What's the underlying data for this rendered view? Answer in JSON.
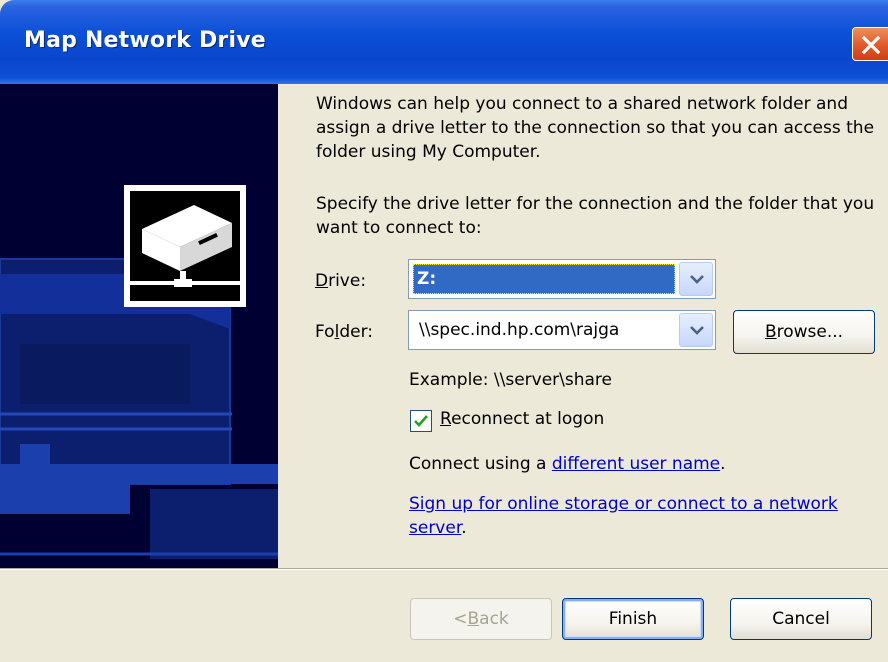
{
  "window": {
    "title": "Map Network Drive"
  },
  "intro": {
    "paragraph1": "Windows can help you connect to a shared network folder and assign a drive letter to the connection so that you can access the folder using My Computer.",
    "paragraph2": "Specify the drive letter for the connection and the folder that you want to connect to:"
  },
  "drive": {
    "label_pre": "",
    "label_accel": "D",
    "label_post": "rive:",
    "value": "Z:"
  },
  "folder": {
    "label_pre": "Fo",
    "label_accel": "l",
    "label_post": "der:",
    "value": "\\\\spec.ind.hp.com\\rajga",
    "browse_accel": "B",
    "browse_post": "rowse..."
  },
  "example_text": "Example: \\\\server\\share",
  "reconnect": {
    "checked": true,
    "label_accel": "R",
    "label_post": "econnect at logon"
  },
  "connect_using": {
    "prefix": "Connect using a ",
    "link": "different user name",
    "suffix": "."
  },
  "signup": {
    "link": "Sign up for online storage or connect to a network server",
    "suffix": "."
  },
  "footer": {
    "back_pre": "< ",
    "back_accel": "B",
    "back_post": "ack",
    "finish_label": "Finish",
    "cancel_label": "Cancel"
  },
  "colors": {
    "titlebar": "#0b4fd8",
    "art_background": "#000033",
    "link": "#0000cc",
    "selection": "#316ac5"
  },
  "icons": [
    "close-icon",
    "network-drive-icon",
    "chevron-down-icon",
    "checkmark-icon"
  ]
}
